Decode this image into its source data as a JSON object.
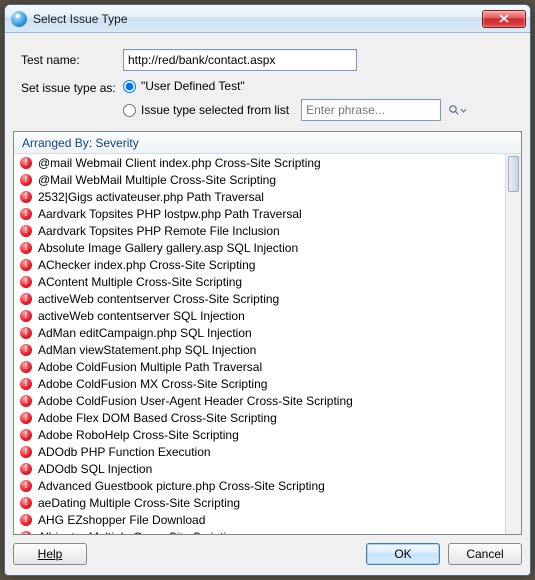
{
  "window": {
    "title": "Select Issue Type"
  },
  "form": {
    "test_name_label": "Test name:",
    "test_name_value": "http://red/bank/contact.aspx",
    "issue_type_label": "Set issue type as:",
    "option_user_defined": "\"User Defined Test\"",
    "option_from_list": "Issue type selected from list",
    "search_placeholder": "Enter phrase..."
  },
  "list": {
    "header": "Arranged By: Severity",
    "items": [
      "@mail Webmail Client index.php Cross-Site Scripting",
      "@Mail WebMail Multiple Cross-Site Scripting",
      "2532|Gigs activateuser.php Path Traversal",
      "Aardvark Topsites PHP lostpw.php Path Traversal",
      "Aardvark Topsites PHP Remote File Inclusion",
      "Absolute Image Gallery gallery.asp SQL Injection",
      "AChecker index.php Cross-Site Scripting",
      "AContent Multiple Cross-Site Scripting",
      "activeWeb contentserver Cross-Site Scripting",
      "activeWeb contentserver SQL Injection",
      "AdMan editCampaign.php SQL Injection",
      "AdMan viewStatement.php SQL Injection",
      "Adobe ColdFusion Multiple Path Traversal",
      "Adobe ColdFusion MX Cross-Site Scripting",
      "Adobe ColdFusion User-Agent Header Cross-Site Scripting",
      "Adobe Flex DOM Based Cross-Site Scripting",
      "Adobe RoboHelp Cross-Site Scripting",
      "ADOdb PHP Function Execution",
      "ADOdb SQL Injection",
      "Advanced Guestbook picture.php Cross-Site Scripting",
      "aeDating Multiple Cross-Site Scripting",
      "AHG EZshopper File Download",
      "Albinator Multiple Cross-Site Scripting"
    ]
  },
  "buttons": {
    "help": "Help",
    "ok": "OK",
    "cancel": "Cancel"
  }
}
